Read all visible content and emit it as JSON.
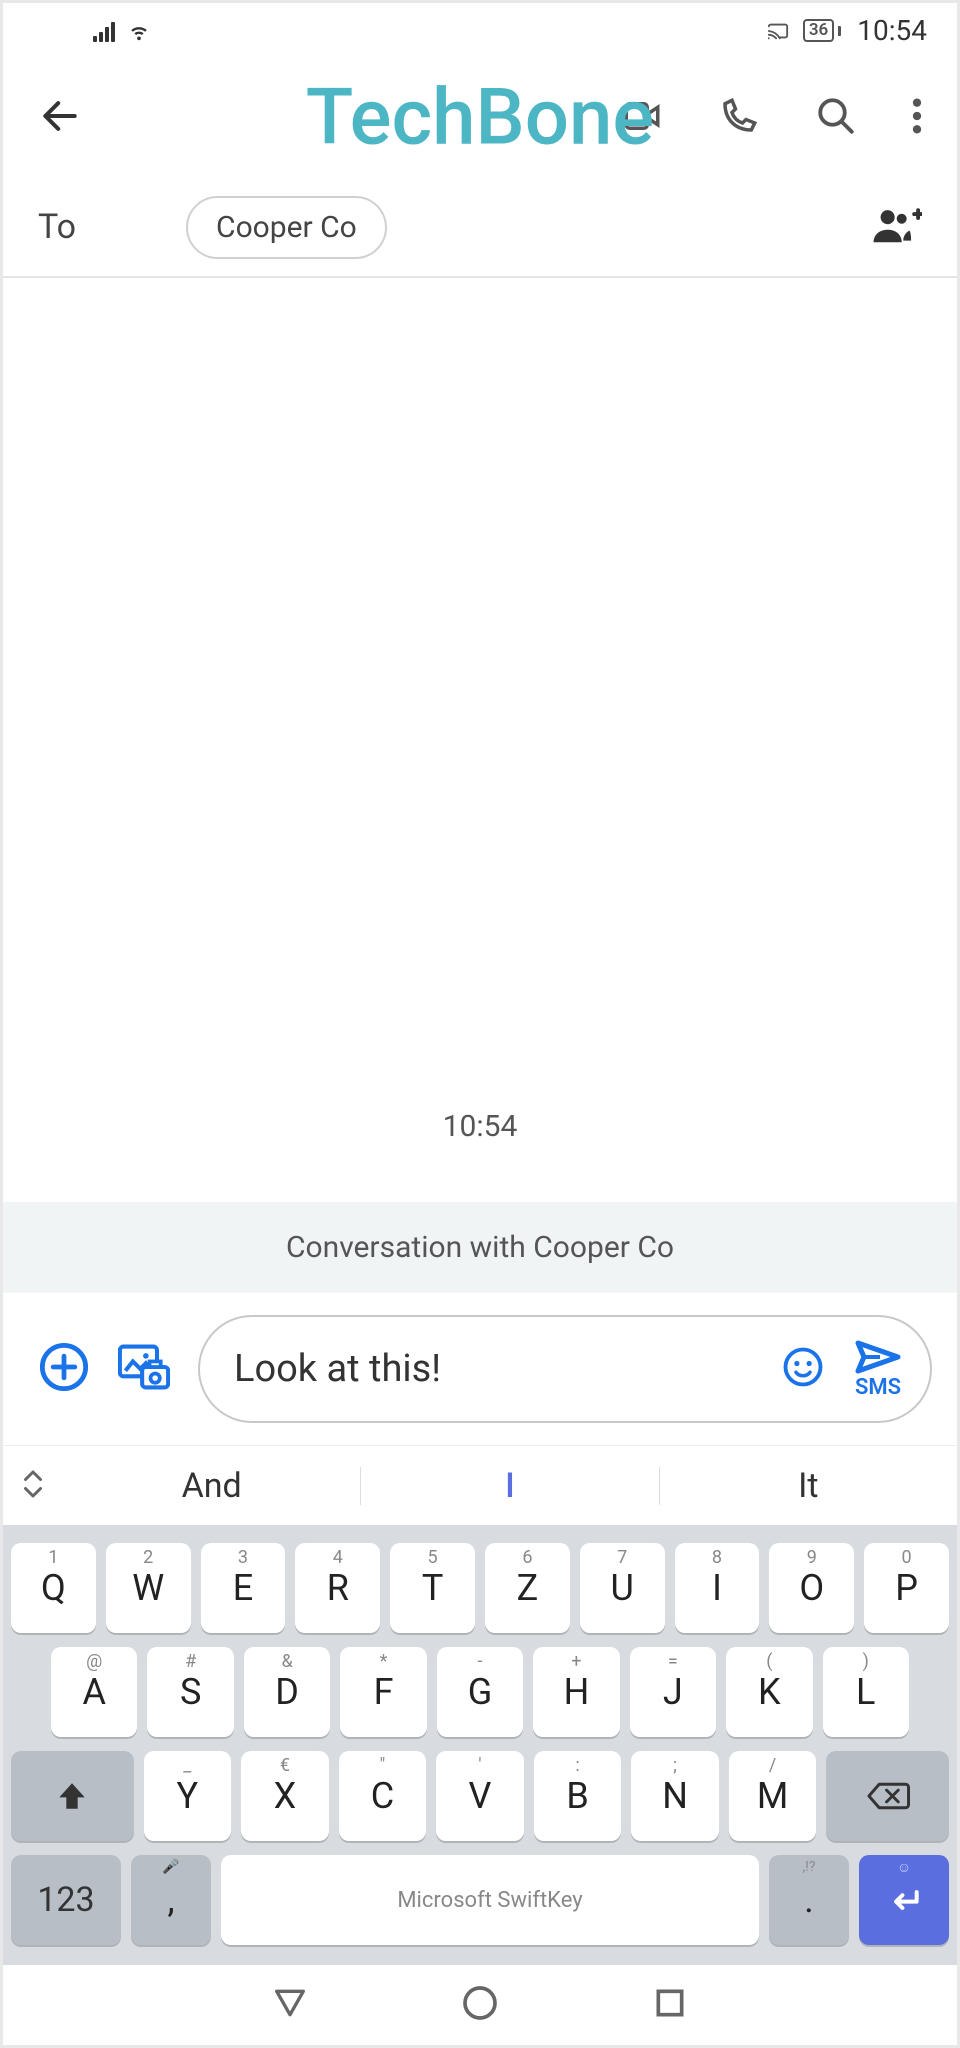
{
  "status": {
    "battery": "36",
    "time": "10:54"
  },
  "watermark": "TechBone",
  "to": {
    "label": "To",
    "contact": "Cooper Co"
  },
  "conversation": {
    "timestamp": "10:54",
    "banner": "Conversation with Cooper Co"
  },
  "compose": {
    "text": "Look at this!",
    "send_label": "SMS"
  },
  "suggestions": {
    "left": "And",
    "mid": "I",
    "right": "It"
  },
  "keyboard": {
    "row1": [
      {
        "main": "Q",
        "sub": "1"
      },
      {
        "main": "W",
        "sub": "2"
      },
      {
        "main": "E",
        "sub": "3"
      },
      {
        "main": "R",
        "sub": "4"
      },
      {
        "main": "T",
        "sub": "5"
      },
      {
        "main": "Z",
        "sub": "6"
      },
      {
        "main": "U",
        "sub": "7"
      },
      {
        "main": "I",
        "sub": "8"
      },
      {
        "main": "O",
        "sub": "9"
      },
      {
        "main": "P",
        "sub": "0"
      }
    ],
    "row2": [
      {
        "main": "A",
        "sub": "@"
      },
      {
        "main": "S",
        "sub": "#"
      },
      {
        "main": "D",
        "sub": "&"
      },
      {
        "main": "F",
        "sub": "*"
      },
      {
        "main": "G",
        "sub": "-"
      },
      {
        "main": "H",
        "sub": "+"
      },
      {
        "main": "J",
        "sub": "="
      },
      {
        "main": "K",
        "sub": "("
      },
      {
        "main": "L",
        "sub": ")"
      }
    ],
    "row3": [
      {
        "main": "Y",
        "sub": "_"
      },
      {
        "main": "X",
        "sub": "€"
      },
      {
        "main": "C",
        "sub": "\""
      },
      {
        "main": "V",
        "sub": "'"
      },
      {
        "main": "B",
        "sub": ":"
      },
      {
        "main": "N",
        "sub": ";"
      },
      {
        "main": "M",
        "sub": "/"
      }
    ],
    "num_label": "123",
    "comma": ",",
    "comma_sub": "🎤",
    "space_label": "Microsoft SwiftKey",
    "period": ".",
    "period_sub": ",!?",
    "enter_sub": "☺"
  }
}
